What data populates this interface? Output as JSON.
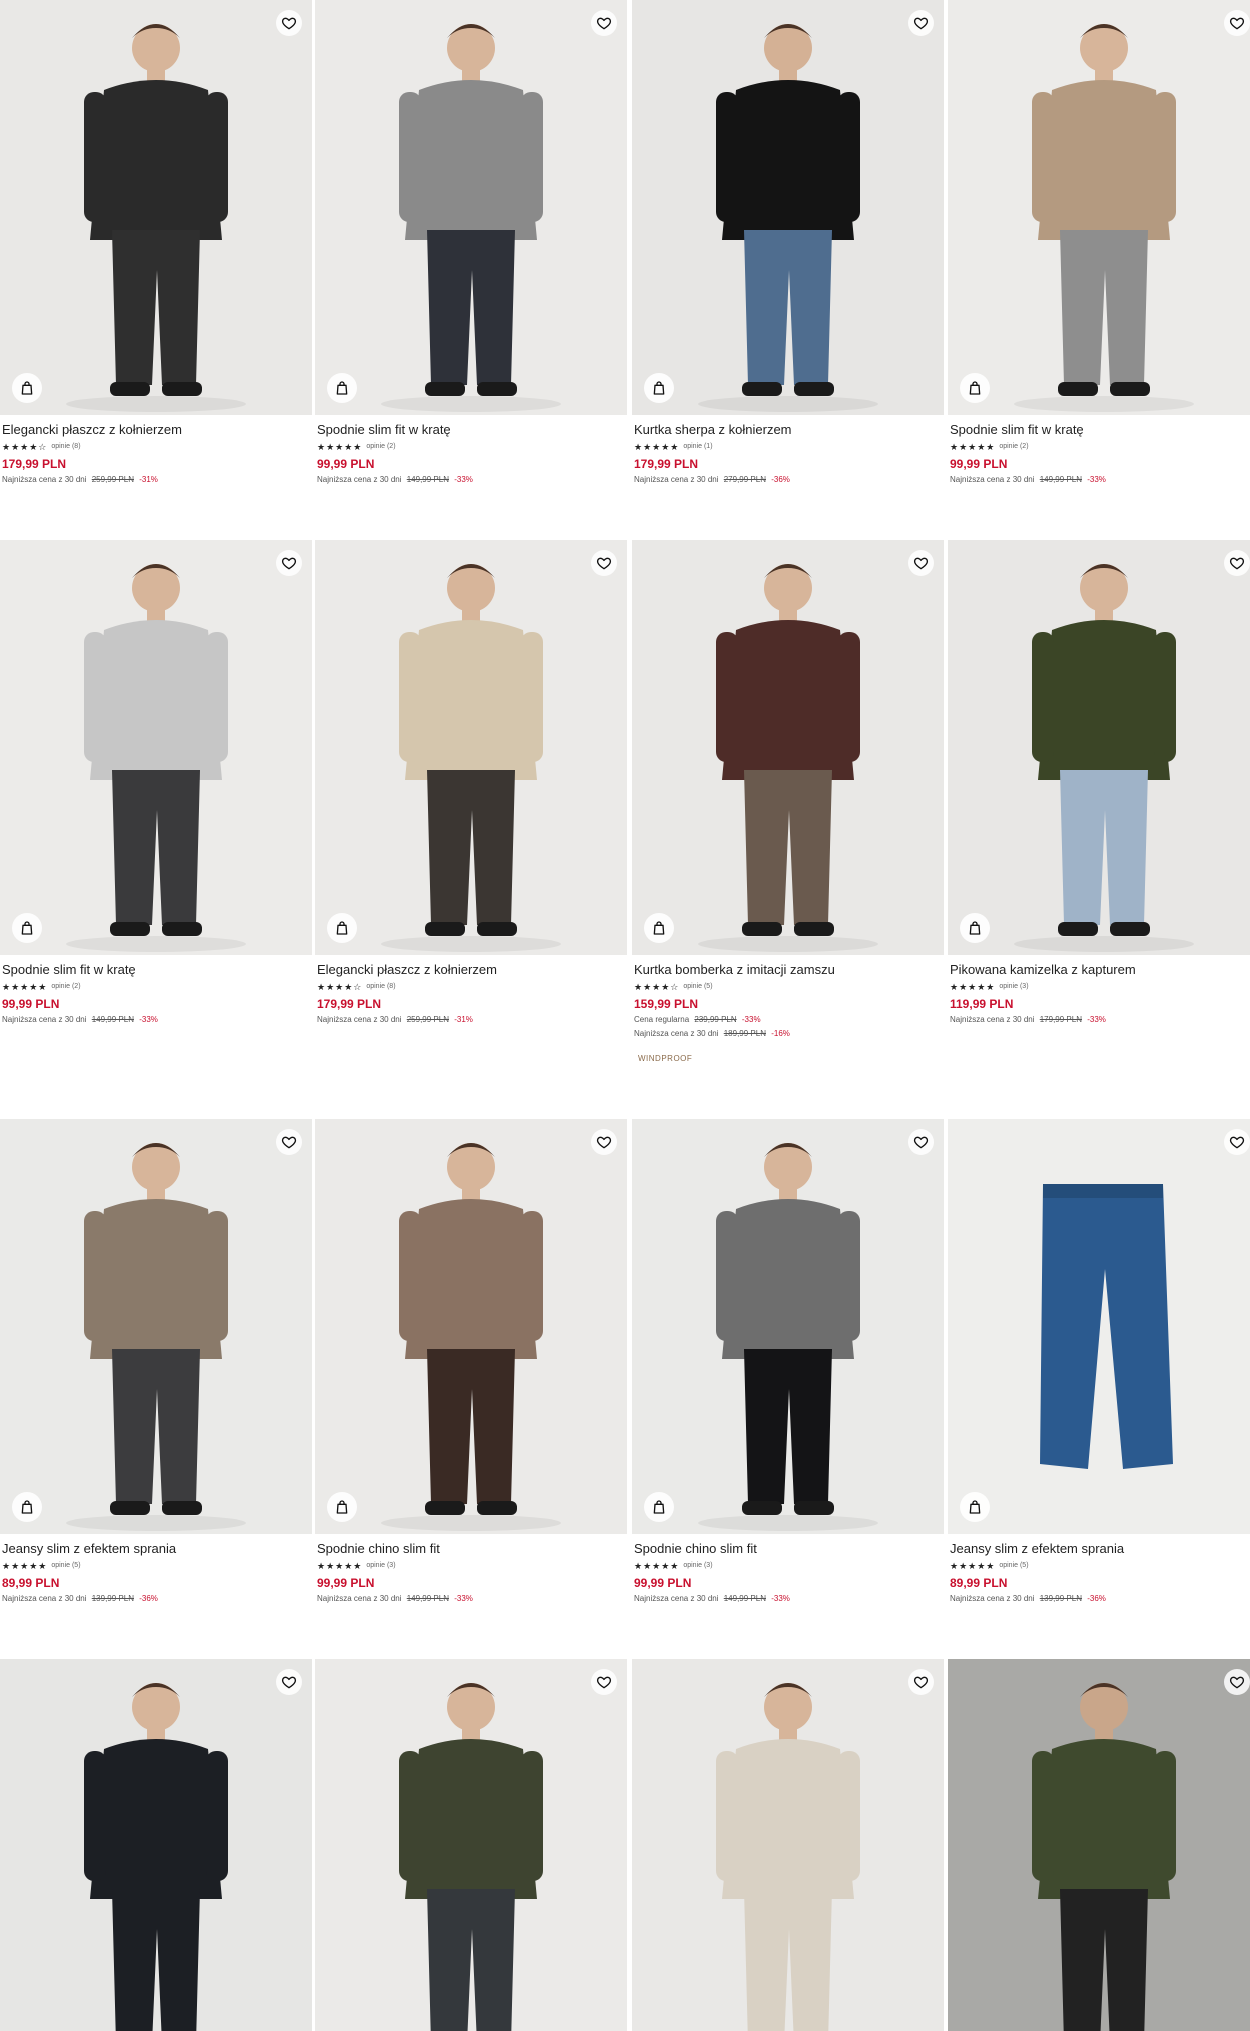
{
  "products": [
    {
      "name": "Elegancki płaszcz z kołnierzem",
      "stars": "★★★★☆",
      "reviews": "opinie (8)",
      "price": "179,99 PLN",
      "lowest_label": "Najniższa cena z 30 dni",
      "old_price": "259,99 PLN",
      "discount": "-31%",
      "colors": {
        "bg": "#e9e8e6",
        "top": "#2a2a2a",
        "bottom": "#2f2f2f",
        "skin": "#d7b59a"
      }
    },
    {
      "name": "Spodnie slim fit w kratę",
      "stars": "★★★★★",
      "reviews": "opinie (2)",
      "price": "99,99 PLN",
      "lowest_label": "Najniższa cena z 30 dni",
      "old_price": "149,99 PLN",
      "discount": "-33%",
      "colors": {
        "bg": "#ebeae8",
        "top": "#8a8a8a",
        "bottom": "#2e3139",
        "skin": "#d7b59a"
      }
    },
    {
      "name": "Kurtka sherpa z kołnierzem",
      "stars": "★★★★★",
      "reviews": "opinie (1)",
      "price": "179,99 PLN",
      "lowest_label": "Najniższa cena z 30 dni",
      "old_price": "279,99 PLN",
      "discount": "-36%",
      "colors": {
        "bg": "#e7e6e4",
        "top": "#141414",
        "bottom": "#4f6d8f",
        "skin": "#d4b195"
      }
    },
    {
      "name": "Spodnie slim fit w kratę",
      "stars": "★★★★★",
      "reviews": "opinie (2)",
      "price": "99,99 PLN",
      "lowest_label": "Najniższa cena z 30 dni",
      "old_price": "149,99 PLN",
      "discount": "-33%",
      "colors": {
        "bg": "#ecebe9",
        "top": "#b49a80",
        "bottom": "#8e8e8e",
        "skin": "#d7b59a"
      }
    },
    {
      "name": "Spodnie slim fit w kratę",
      "stars": "★★★★★",
      "reviews": "opinie (2)",
      "price": "99,99 PLN",
      "lowest_label": "Najniższa cena z 30 dni",
      "old_price": "149,99 PLN",
      "discount": "-33%",
      "colors": {
        "bg": "#ecebe9",
        "top": "#c6c6c6",
        "bottom": "#3a3a3c",
        "skin": "#d7b59a"
      }
    },
    {
      "name": "Elegancki płaszcz z kołnierzem",
      "stars": "★★★★☆",
      "reviews": "opinie (8)",
      "price": "179,99 PLN",
      "lowest_label": "Najniższa cena z 30 dni",
      "old_price": "259,99 PLN",
      "discount": "-31%",
      "colors": {
        "bg": "#ebeae8",
        "top": "#d5c6ad",
        "bottom": "#3b3632",
        "skin": "#d7b59a"
      }
    },
    {
      "name": "Kurtka bomberka z imitacji zamszu",
      "stars": "★★★★☆",
      "reviews": "opinie (5)",
      "price": "159,99 PLN",
      "regular_label": "Cena regularna",
      "regular_price": "239,99 PLN",
      "regular_discount": "-33%",
      "lowest_label": "Najniższa cena z 30 dni",
      "old_price": "189,99 PLN",
      "discount": "-16%",
      "tag": "WINDPROOF",
      "colors": {
        "bg": "#e9e8e6",
        "top": "#4e2c28",
        "bottom": "#6a5a4e",
        "skin": "#d7b59a"
      }
    },
    {
      "name": "Pikowana kamizelka z kapturem",
      "stars": "★★★★★",
      "reviews": "opinie (3)",
      "price": "119,99 PLN",
      "lowest_label": "Najniższa cena z 30 dni",
      "old_price": "179,99 PLN",
      "discount": "-33%",
      "colors": {
        "bg": "#e8e7e5",
        "top": "#3b4526",
        "bottom": "#9fb3c8",
        "skin": "#d7b59a"
      }
    },
    {
      "name": "Jeansy slim z efektem sprania",
      "stars": "★★★★★",
      "reviews": "opinie (5)",
      "price": "89,99 PLN",
      "lowest_label": "Najniższa cena z 30 dni",
      "old_price": "139,99 PLN",
      "discount": "-36%",
      "colors": {
        "bg": "#eaeae8",
        "top": "#8a7a6a",
        "bottom": "#3c3c3e",
        "skin": "#d7b59a"
      }
    },
    {
      "name": "Spodnie chino slim fit",
      "stars": "★★★★★",
      "reviews": "opinie (3)",
      "price": "99,99 PLN",
      "lowest_label": "Najniższa cena z 30 dni",
      "old_price": "149,99 PLN",
      "discount": "-33%",
      "colors": {
        "bg": "#ebeae8",
        "top": "#8a7262",
        "bottom": "#3a2a24",
        "skin": "#d7b59a"
      }
    },
    {
      "name": "Spodnie chino slim fit",
      "stars": "★★★★★",
      "reviews": "opinie (3)",
      "price": "99,99 PLN",
      "lowest_label": "Najniższa cena z 30 dni",
      "old_price": "149,99 PLN",
      "discount": "-33%",
      "colors": {
        "bg": "#eaeae8",
        "top": "#6e6e6e",
        "bottom": "#141416",
        "skin": "#d7b59a"
      }
    },
    {
      "name": "Jeansy slim z efektem sprania",
      "stars": "★★★★★",
      "reviews": "opinie (5)",
      "price": "89,99 PLN",
      "lowest_label": "Najniższa cena z 30 dni",
      "old_price": "139,99 PLN",
      "discount": "-36%",
      "colors": {
        "bg": "#eeeeec",
        "top": "#eeeeec",
        "bottom": "#2b5a8f",
        "skin": "#eeeeec"
      }
    },
    {
      "colors": {
        "bg": "#e6e6e4",
        "top": "#1c1f24",
        "bottom": "#1c1f24",
        "skin": "#d7b59a"
      }
    },
    {
      "colors": {
        "bg": "#ebeae8",
        "top": "#3e4430",
        "bottom": "#34383c",
        "skin": "#d7b59a"
      }
    },
    {
      "colors": {
        "bg": "#e9e8e6",
        "top": "#d9d1c4",
        "bottom": "#d9d1c4",
        "skin": "#d7b59a"
      }
    },
    {
      "colors": {
        "bg": "#a9a9a6",
        "top": "#3f4a2e",
        "bottom": "#222222",
        "skin": "#c9a68a"
      }
    }
  ],
  "icons": {
    "wishlist": "heart-icon",
    "bag": "shopping-bag-icon"
  }
}
